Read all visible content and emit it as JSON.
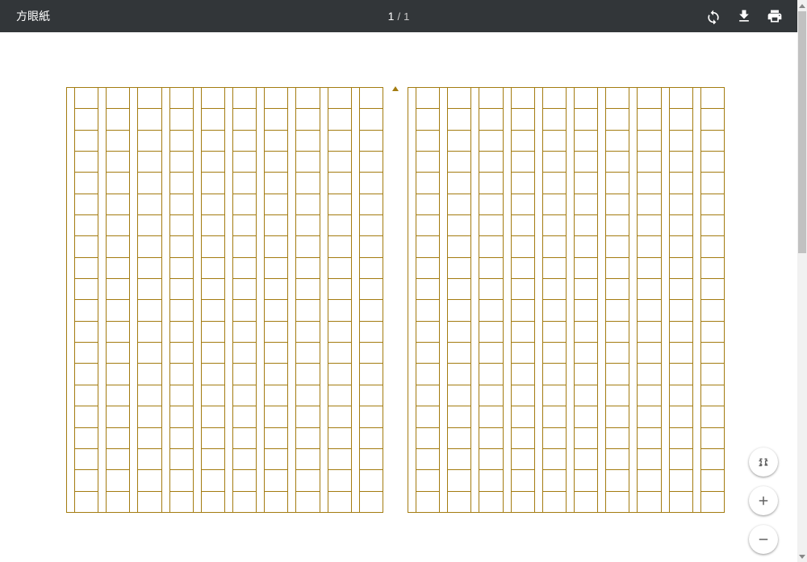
{
  "toolbar": {
    "title": "方眼紙",
    "page_current": "1",
    "page_separator": "/",
    "page_total": "1",
    "icons": {
      "rotate": "rotate-icon",
      "download": "download-icon",
      "print": "print-icon"
    }
  },
  "document": {
    "type": "genko-yoshi",
    "grid_line_color": "#a37b0f",
    "columns_per_block": 10,
    "blocks": 2,
    "rows_per_column": 20
  },
  "float": {
    "fit": "fit-page",
    "zoom_in": "+",
    "zoom_out": "−"
  }
}
